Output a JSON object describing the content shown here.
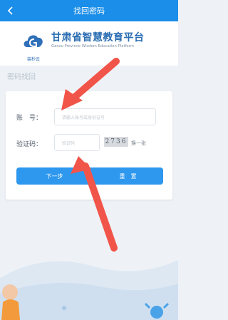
{
  "header": {
    "title": "找回密码",
    "back_icon": "chevron-left-icon"
  },
  "brand": {
    "logo_sub": "装秒云",
    "title": "甘肃省智慧教育平台",
    "subtitle": "Gansu Province Wisdom Education Platform"
  },
  "section_title": "密码找回",
  "form": {
    "account_label": "账　号：",
    "account_placeholder": "请输入账号或身份证号",
    "captcha_label": "验证码：",
    "captcha_placeholder": "验证码",
    "captcha_text": "2736",
    "refresh_label": "换一张",
    "next_label": "下一步",
    "reset_label": "重　置"
  },
  "colors": {
    "primary": "#1a8ee8",
    "button": "#2e97ee",
    "arrow": "#f1554a"
  }
}
